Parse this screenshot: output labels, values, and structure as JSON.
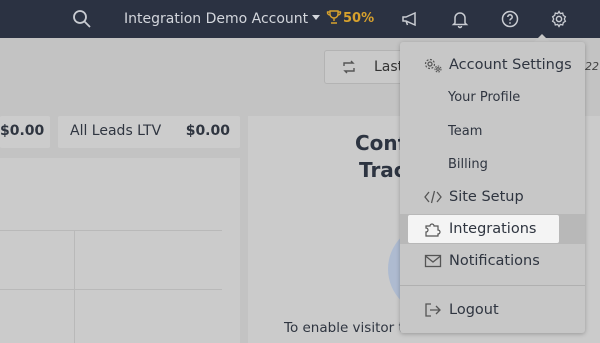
{
  "topbar": {
    "account_name": "Integration Demo Account",
    "progress": "50%",
    "icons": [
      "search-icon",
      "megaphone-icon",
      "bell-icon",
      "help-icon",
      "gear-icon"
    ]
  },
  "toolbar": {
    "range_label": "Last",
    "range_tail": "22"
  },
  "stats": [
    {
      "label": "",
      "value": "$0.00"
    },
    {
      "label": "All Leads LTV",
      "value": "$0.00"
    }
  ],
  "cta": {
    "title_line1": "Conf",
    "title_line2": "Trac",
    "body": "To enable visitor t"
  },
  "menu": {
    "items": [
      {
        "label": "Account Settings",
        "icon": "gears-icon",
        "type": "section"
      },
      {
        "label": "Your Profile",
        "type": "sub"
      },
      {
        "label": "Team",
        "type": "sub"
      },
      {
        "label": "Billing",
        "type": "sub"
      },
      {
        "label": "Site Setup",
        "icon": "code-icon",
        "type": "section"
      },
      {
        "label": "Integrations",
        "icon": "puzzle-icon",
        "type": "section",
        "active": true
      },
      {
        "label": "Notifications",
        "icon": "envelope-icon",
        "type": "section"
      },
      {
        "label": "Logout",
        "icon": "logout-icon",
        "type": "section"
      }
    ]
  },
  "colors": {
    "topbar": "#2b3242",
    "accent_gold": "#d7a12d",
    "menu_bg": "#c7c7c7",
    "active_highlight": "#f4f4f4"
  }
}
